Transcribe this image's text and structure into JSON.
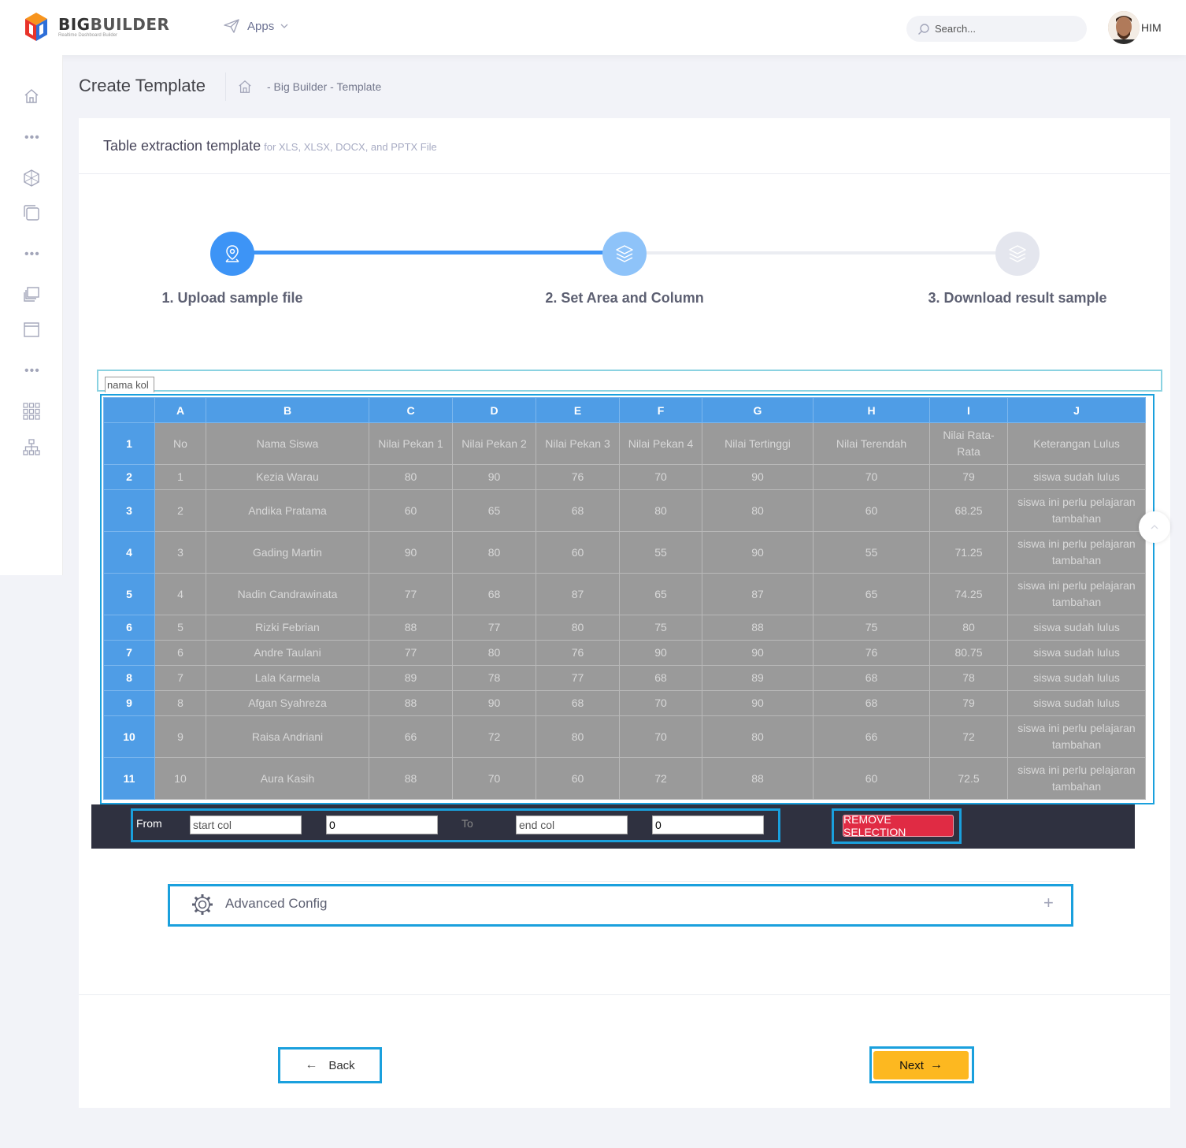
{
  "header": {
    "logo_title_big": "BIG",
    "logo_title_builder": "BUILDER",
    "logo_tagline": "Realtime Dashboard Builder",
    "apps_label": "Apps",
    "search_placeholder": "Search...",
    "user_name": "HIM"
  },
  "sidebar": {
    "items": [
      "home-icon",
      "dots",
      "hexagon-icon",
      "files-icon",
      "dots",
      "layers-icon",
      "window-icon",
      "dots",
      "grid-icon",
      "sitemap-icon"
    ]
  },
  "page": {
    "title": "Create Template",
    "breadcrumb": "- Big Builder - Template"
  },
  "portlet": {
    "title": "Table extraction template",
    "subtitle": "for XLS, XLSX, DOCX, and PPTX File"
  },
  "wizard": {
    "steps": [
      {
        "label": "1. Upload sample file",
        "state": "done"
      },
      {
        "label": "2. Set Area and Column",
        "state": "current"
      },
      {
        "label": "3. Download result sample",
        "state": "pending"
      }
    ],
    "colors": {
      "done": "#3d94f6",
      "current": "#8ec3f9",
      "pending": "#e4e6ee"
    }
  },
  "column_name_input": "nama kol",
  "sheet": {
    "col_headers": [
      "",
      "A",
      "B",
      "C",
      "D",
      "E",
      "F",
      "G",
      "H",
      "I",
      "J"
    ],
    "rows": [
      {
        "n": "1",
        "cells": [
          "No",
          "Nama Siswa",
          "Nilai Pekan 1",
          "Nilai Pekan 2",
          "Nilai Pekan 3",
          "Nilai Pekan 4",
          "Nilai Tertinggi",
          "Nilai Terendah",
          "Nilai Rata-Rata",
          "Keterangan Lulus"
        ]
      },
      {
        "n": "2",
        "cells": [
          "1",
          "Kezia Warau",
          "80",
          "90",
          "76",
          "70",
          "90",
          "70",
          "79",
          "siswa sudah lulus"
        ]
      },
      {
        "n": "3",
        "cells": [
          "2",
          "Andika Pratama",
          "60",
          "65",
          "68",
          "80",
          "80",
          "60",
          "68.25",
          "siswa ini perlu pelajaran tambahan"
        ]
      },
      {
        "n": "4",
        "cells": [
          "3",
          "Gading Martin",
          "90",
          "80",
          "60",
          "55",
          "90",
          "55",
          "71.25",
          "siswa ini perlu pelajaran tambahan"
        ]
      },
      {
        "n": "5",
        "cells": [
          "4",
          "Nadin Candrawinata",
          "77",
          "68",
          "87",
          "65",
          "87",
          "65",
          "74.25",
          "siswa ini perlu pelajaran tambahan"
        ]
      },
      {
        "n": "6",
        "cells": [
          "5",
          "Rizki Febrian",
          "88",
          "77",
          "80",
          "75",
          "88",
          "75",
          "80",
          "siswa sudah lulus"
        ]
      },
      {
        "n": "7",
        "cells": [
          "6",
          "Andre Taulani",
          "77",
          "80",
          "76",
          "90",
          "90",
          "76",
          "80.75",
          "siswa sudah lulus"
        ]
      },
      {
        "n": "8",
        "cells": [
          "7",
          "Lala Karmela",
          "89",
          "78",
          "77",
          "68",
          "89",
          "68",
          "78",
          "siswa sudah lulus"
        ]
      },
      {
        "n": "9",
        "cells": [
          "8",
          "Afgan Syahreza",
          "88",
          "90",
          "68",
          "70",
          "90",
          "68",
          "79",
          "siswa sudah lulus"
        ]
      },
      {
        "n": "10",
        "cells": [
          "9",
          "Raisa Andriani",
          "66",
          "72",
          "80",
          "70",
          "80",
          "66",
          "72",
          "siswa ini perlu pelajaran tambahan"
        ]
      },
      {
        "n": "11",
        "cells": [
          "10",
          "Aura Kasih",
          "88",
          "70",
          "60",
          "72",
          "88",
          "60",
          "72.5",
          "siswa ini perlu pelajaran tambahan"
        ]
      }
    ]
  },
  "selection": {
    "from_label": "From",
    "to_label": "To",
    "start_col_placeholder": "start col",
    "start_value": "0",
    "end_col_placeholder": "end col",
    "end_value": "0",
    "remove_label": "REMOVE SELECTION"
  },
  "advanced": {
    "label": "Advanced Config",
    "expand_symbol": "+"
  },
  "footer": {
    "back_label": "Back",
    "next_label": "Next"
  },
  "colors": {
    "accent": "#3d94f6",
    "highlight": "#1aa0dd",
    "danger": "#e02b44",
    "warning": "#fdb820"
  }
}
